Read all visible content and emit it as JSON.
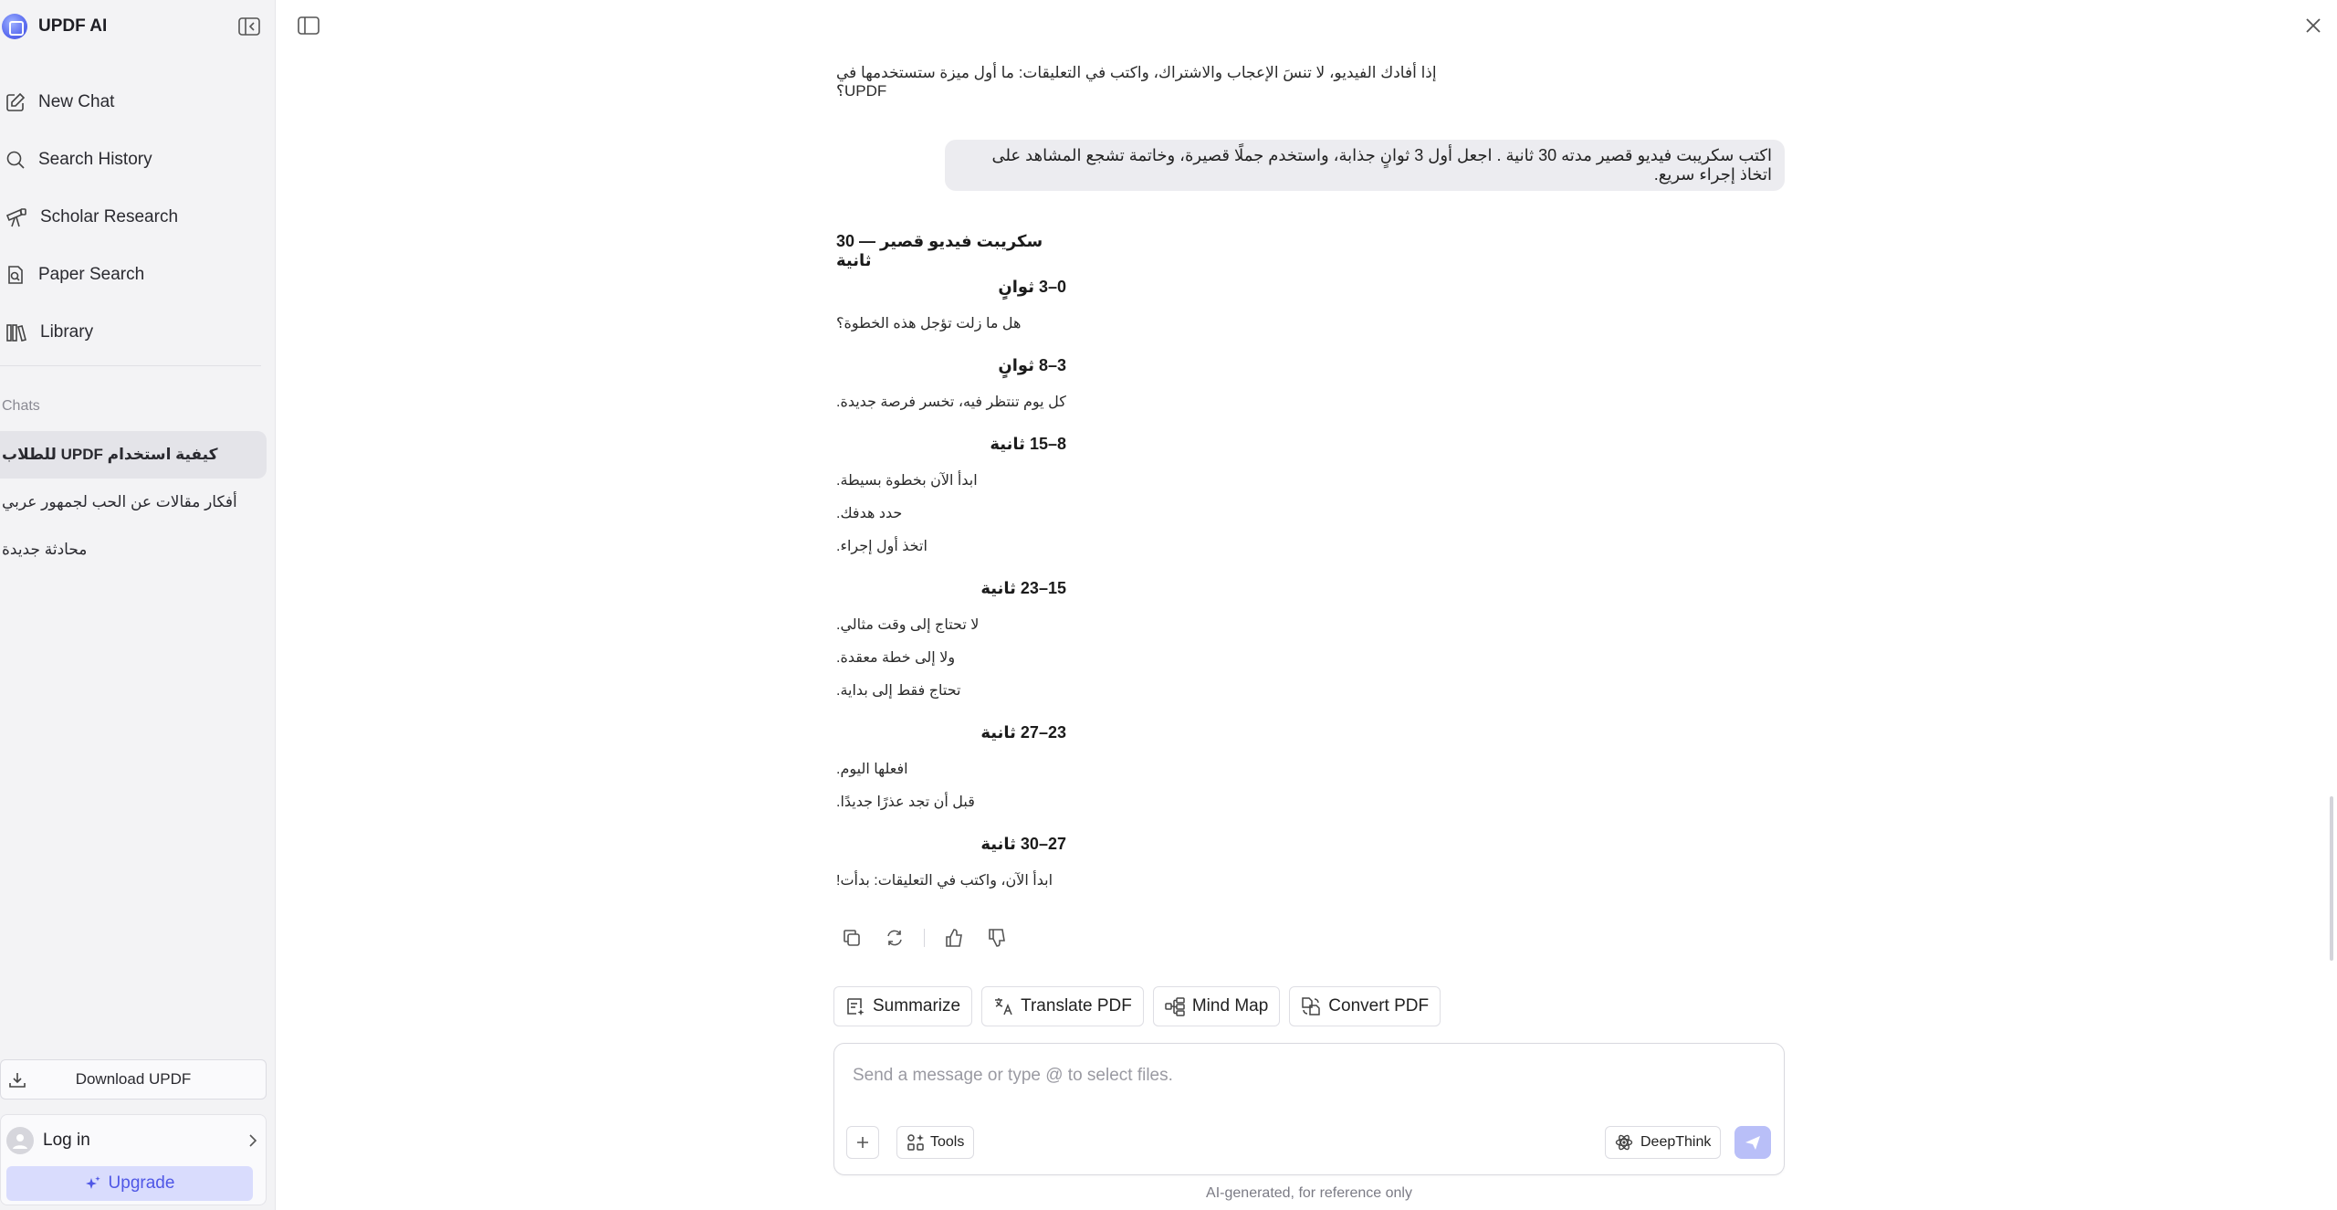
{
  "app": {
    "name": "UPDF AI"
  },
  "sidebar": {
    "nav": [
      {
        "label": "New Chat",
        "icon": "edit-icon"
      },
      {
        "label": "Search History",
        "icon": "search-icon"
      },
      {
        "label": "Scholar Research",
        "icon": "telescope-icon"
      },
      {
        "label": "Paper Search",
        "icon": "document-search-icon"
      },
      {
        "label": "Library",
        "icon": "library-icon"
      }
    ],
    "chats_label": "Chats",
    "chats": [
      {
        "title": "كيفية استخدام UPDF للطلاب",
        "active": true
      },
      {
        "title": "أفكار مقالات عن الحب لجمهور عربي",
        "active": false
      },
      {
        "title": "محادثة جديدة",
        "active": false
      }
    ],
    "download_label": "Download UPDF",
    "login_label": "Log in",
    "upgrade_label": "Upgrade"
  },
  "conversation": {
    "previous_tail": "إذا أفادك الفيديو، لا تنسَ الإعجاب والاشتراك، واكتب في التعليقات: ما أول ميزة ستستخدمها في UPDF؟",
    "user_message": "اكتب سكريبت فيديو قصير مدته 30 ثانية . اجعل أول 3 ثوانٍ جذابة، واستخدم جملًا قصيرة، وخاتمة تشجع المشاهد على اتخاذ إجراء سريع.",
    "answer": {
      "title": "سكريبت فيديو قصير — 30 ثانية",
      "segments": [
        {
          "heading": "0–3 ثوانٍ",
          "lines": [
            "هل ما زلت تؤجل هذه الخطوة؟"
          ]
        },
        {
          "heading": "3–8 ثوانٍ",
          "lines": [
            "كل يوم تنتظر فيه، تخسر فرصة جديدة."
          ]
        },
        {
          "heading": "8–15 ثانية",
          "lines": [
            "ابدأ الآن بخطوة بسيطة.",
            "حدد هدفك.",
            "اتخذ أول إجراء."
          ]
        },
        {
          "heading": "15–23 ثانية",
          "lines": [
            "لا تحتاج إلى وقت مثالي.",
            "ولا إلى خطة معقدة.",
            "تحتاج فقط إلى بداية."
          ]
        },
        {
          "heading": "23–27 ثانية",
          "lines": [
            "افعلها اليوم.",
            "قبل أن تجد عذرًا جديدًا."
          ]
        },
        {
          "heading": "27–30 ثانية",
          "lines": [
            "ابدأ الآن، واكتب في التعليقات: بدأت!"
          ]
        }
      ]
    }
  },
  "tools": [
    {
      "label": "Summarize",
      "icon": "summarize-icon"
    },
    {
      "label": "Translate PDF",
      "icon": "translate-icon"
    },
    {
      "label": "Mind Map",
      "icon": "mind-map-icon"
    },
    {
      "label": "Convert PDF",
      "icon": "convert-icon"
    }
  ],
  "composer": {
    "placeholder": "Send a message or type @ to select files.",
    "tools_label": "Tools",
    "deepthink_label": "DeepThink"
  },
  "footnote": "AI-generated, for reference only",
  "colors": {
    "accent": "#5b63f0",
    "upgrade_bg": "#d9dcfd",
    "send_bg": "#b9bff8"
  }
}
